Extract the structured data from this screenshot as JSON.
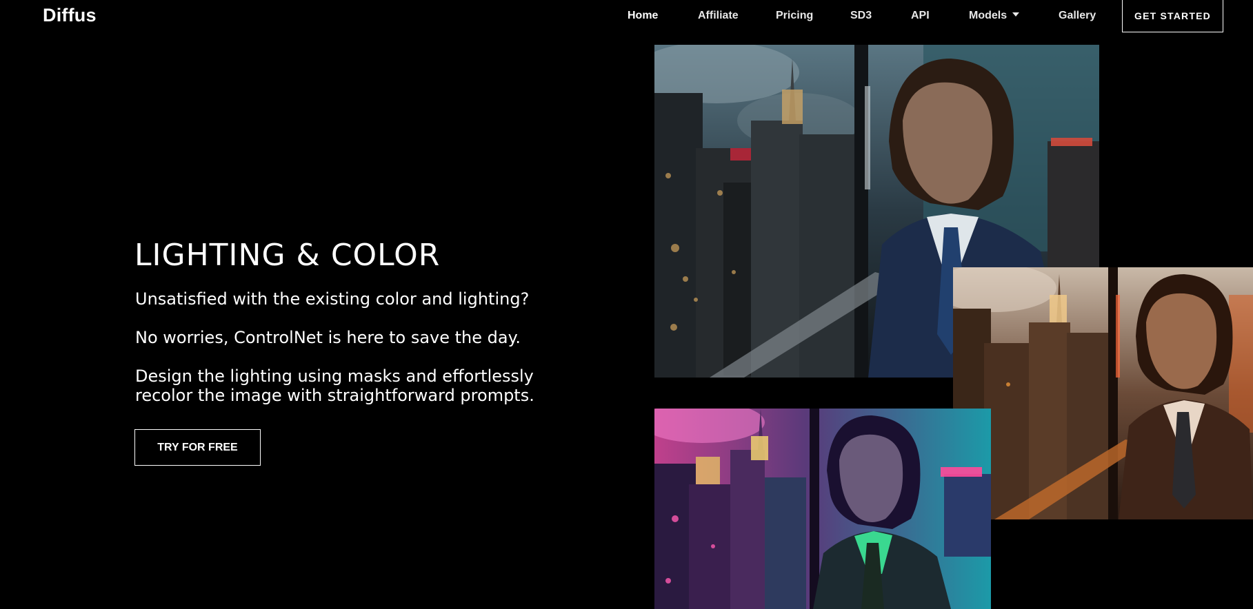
{
  "header": {
    "logo": "Diffus",
    "nav": [
      {
        "label": "Home",
        "active": true
      },
      {
        "label": "Affiliate"
      },
      {
        "label": "Pricing"
      },
      {
        "label": "SD3"
      },
      {
        "label": "API"
      },
      {
        "label": "Models",
        "has_dropdown": true
      },
      {
        "label": "Gallery"
      }
    ],
    "cta": "GET STARTED"
  },
  "hero": {
    "title": "LIGHTING & COLOR",
    "paragraphs": [
      "Unsatisfied with the existing color and lighting?",
      "No worries, ControlNet is here to save the day.",
      "Design the lighting using masks and effortlessly\nrecolor the image with straightforward prompts."
    ],
    "button": "TRY FOR FREE"
  },
  "images": [
    {
      "variant": "original-night-blue",
      "accent": "#2f5f6b"
    },
    {
      "variant": "warm-sunset-orange",
      "accent": "#c0551e"
    },
    {
      "variant": "neon-pink-teal",
      "accent": "#d23aa8"
    }
  ]
}
